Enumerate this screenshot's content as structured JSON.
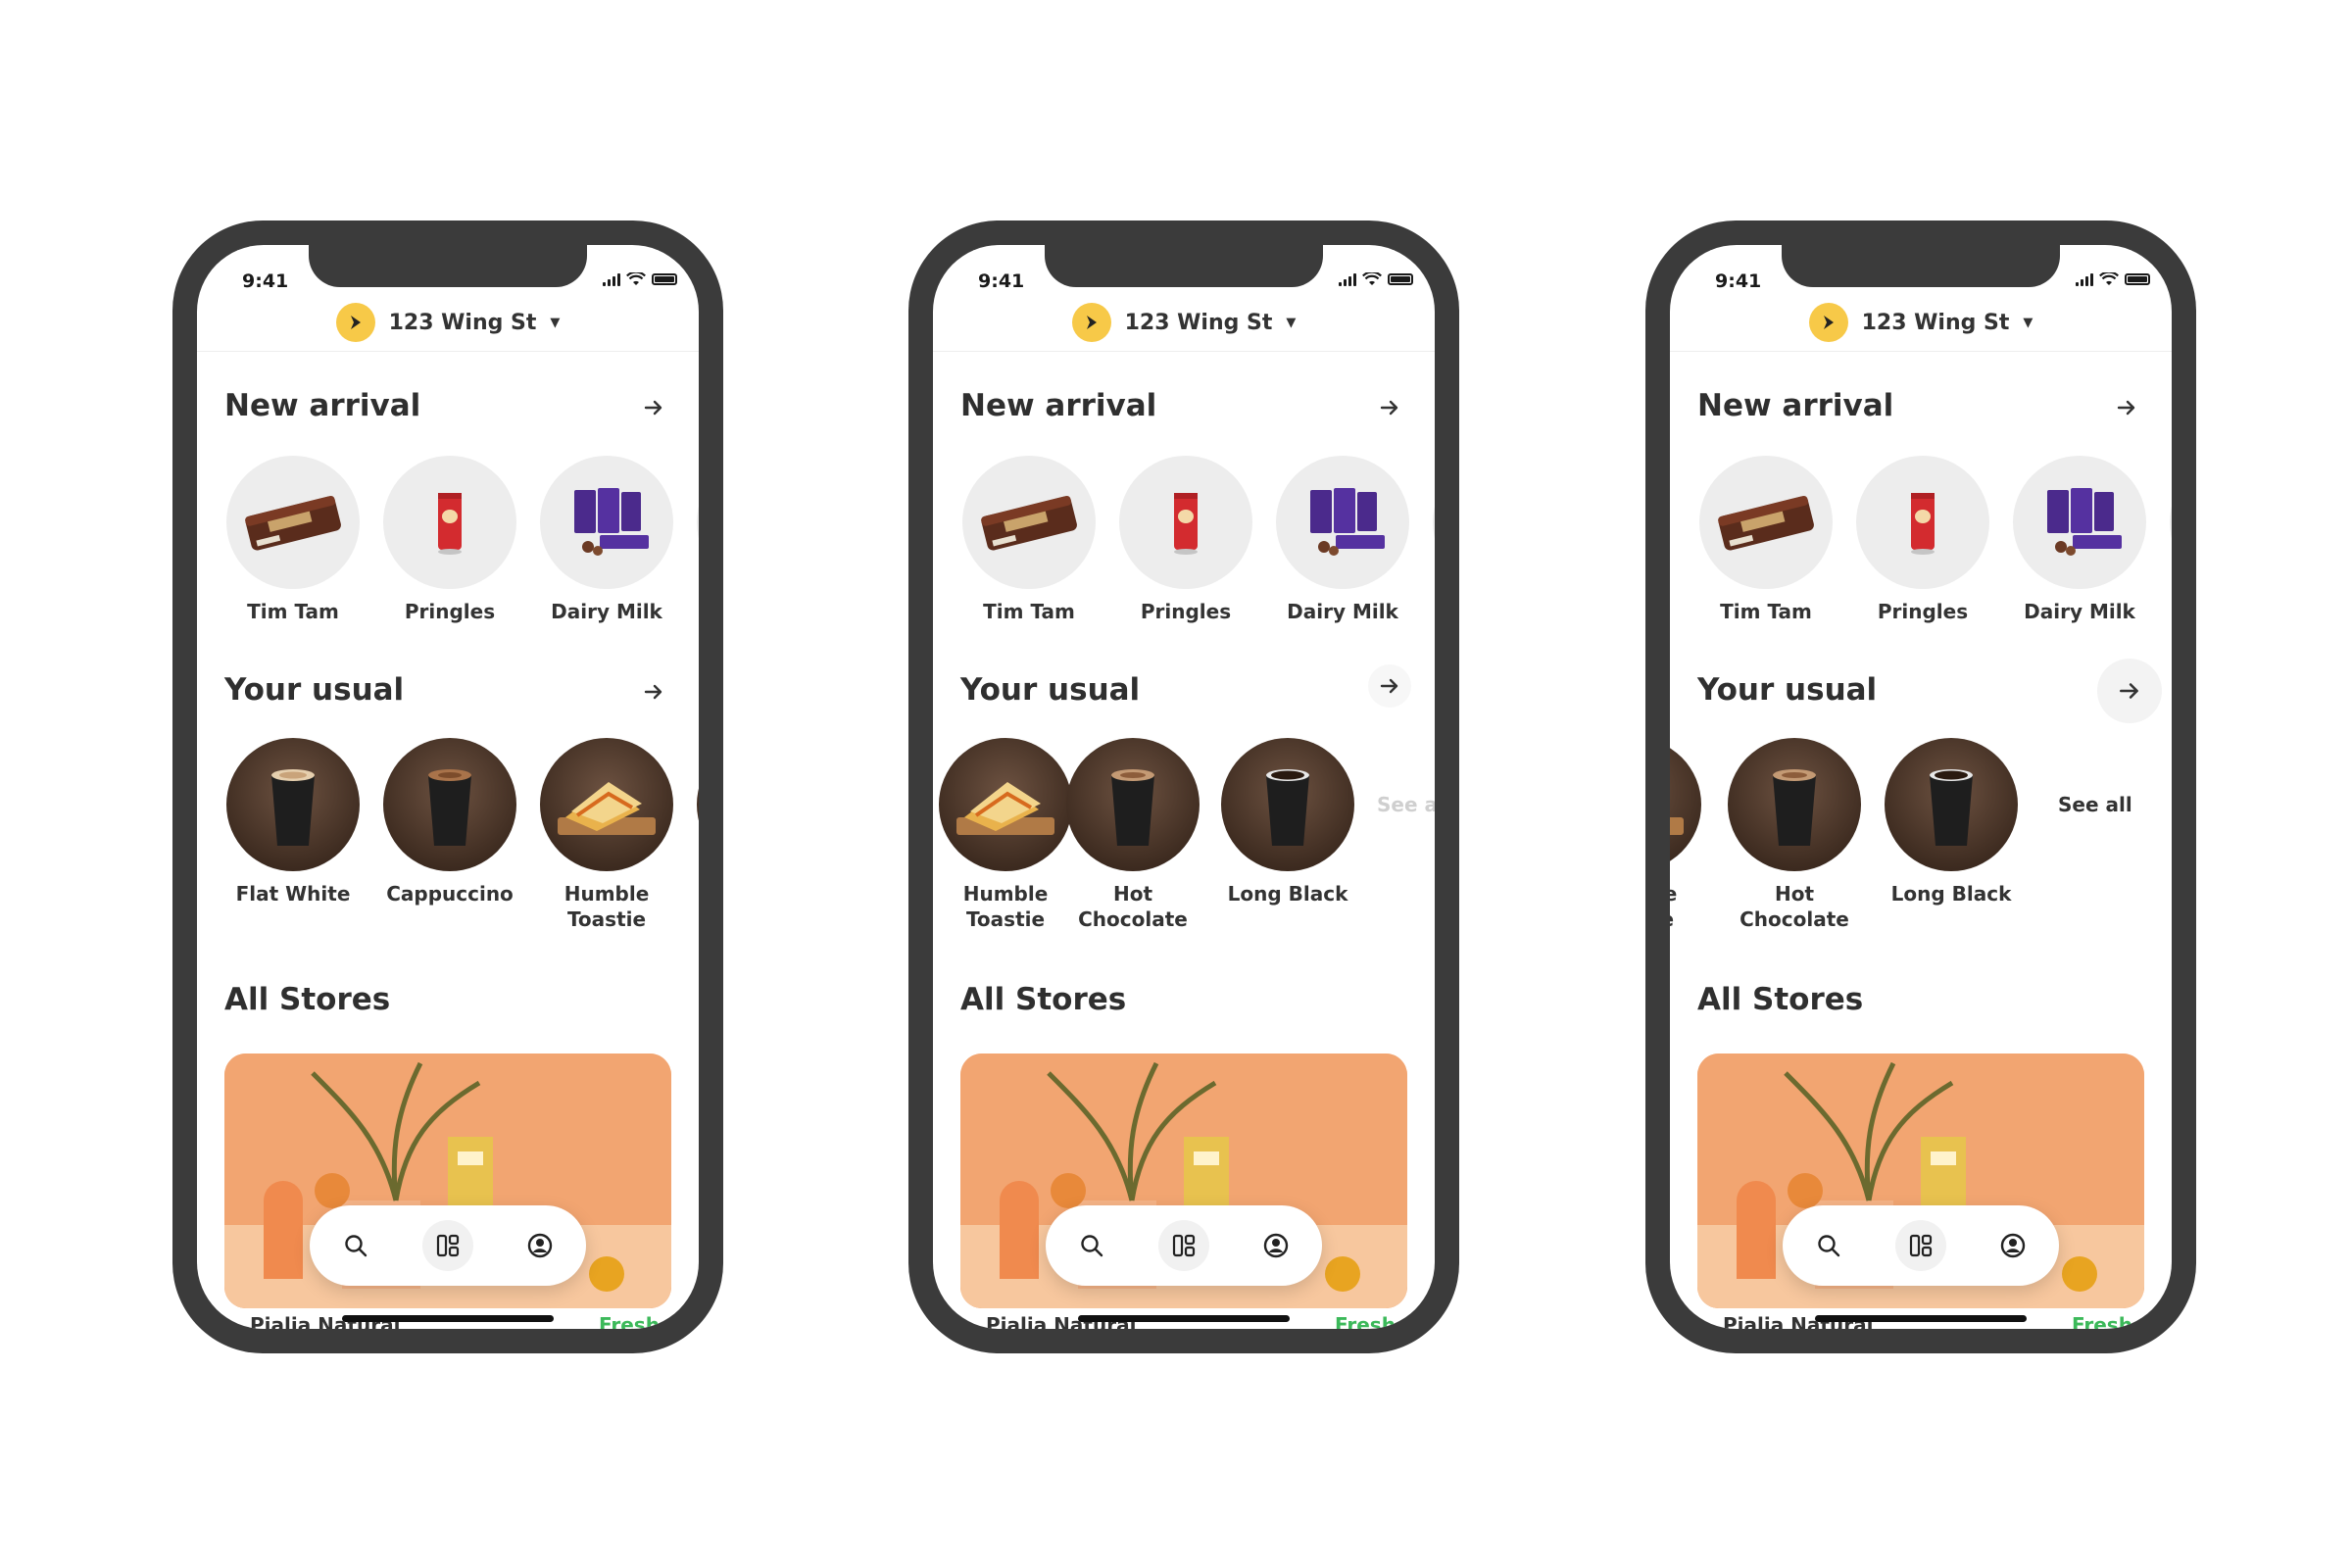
{
  "status": {
    "time": "9:41"
  },
  "header": {
    "address": "123 Wing St"
  },
  "sections": {
    "new_arrival": "New arrival",
    "your_usual": "Your usual",
    "all_stores": "All Stores"
  },
  "new_arrival_items": [
    "Tim Tam",
    "Pringles",
    "Dairy Milk"
  ],
  "usual_items": {
    "flat_white": "Flat White",
    "cappuccino": "Cappuccino",
    "humble_toastie": [
      "Humble",
      "Toastie"
    ],
    "hot_chocolate": [
      "Hot",
      "Chocolate"
    ],
    "long_black": "Long Black"
  },
  "see_all": "See all",
  "see_all_partial": "See a",
  "store_peek": {
    "name": "Pialia Natural",
    "status": "Fresh"
  },
  "nav": [
    "search-icon",
    "stores-icon",
    "profile-icon"
  ],
  "colors": {
    "brand_yellow": "#f7c948",
    "frame": "#3b3b3b",
    "store_orange": "#f2a571",
    "status_green": "#3cb95a"
  }
}
